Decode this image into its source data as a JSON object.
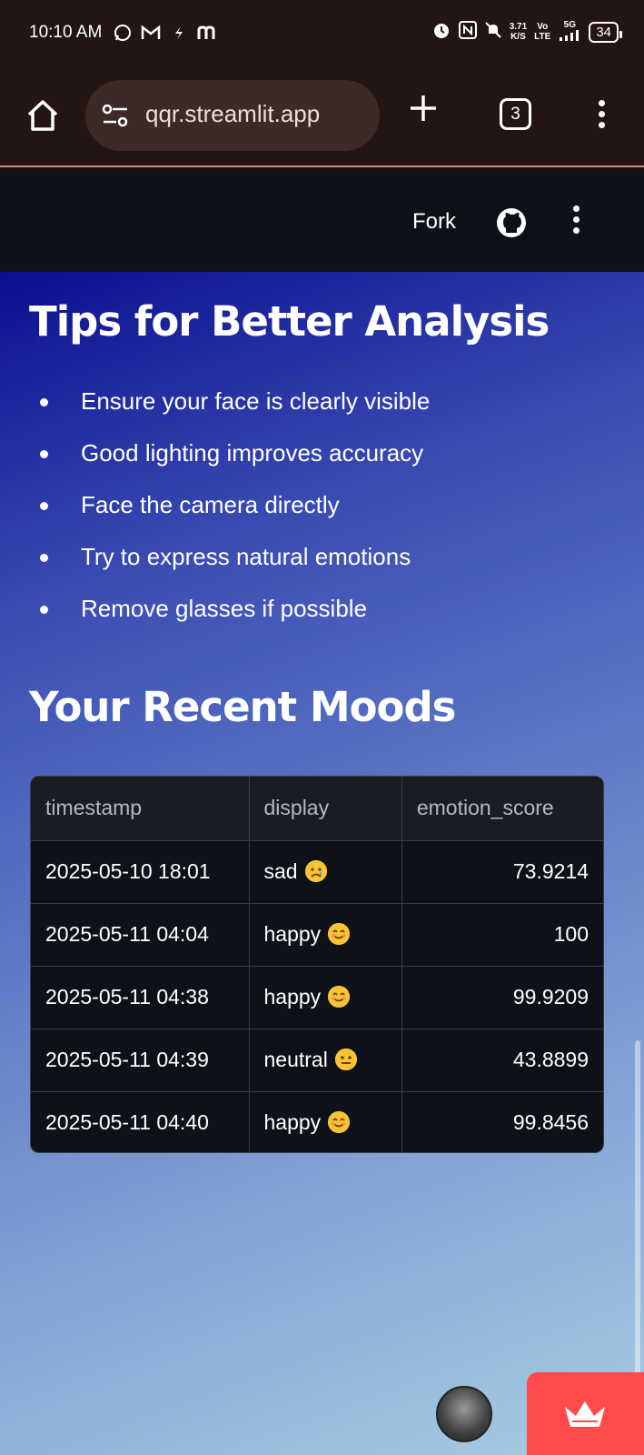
{
  "status_bar": {
    "time": "10:10 AM",
    "app_icons": [
      "whatsapp-icon",
      "gmail-icon",
      "flash-icon",
      "m-icon"
    ],
    "net_speed_value": "3.71",
    "net_speed_unit": "K/S",
    "volte_top": "Vo",
    "volte_bottom": "LTE",
    "network": "5G",
    "battery": "34"
  },
  "browser": {
    "url": "qqr.streamlit.app",
    "tab_count": "3"
  },
  "app_header": {
    "fork_label": "Fork"
  },
  "tips": {
    "title": "Tips for Better Analysis",
    "items": [
      "Ensure your face is clearly visible",
      "Good lighting improves accuracy",
      "Face the camera directly",
      "Try to express natural emotions",
      "Remove glasses if possible"
    ]
  },
  "moods": {
    "title": "Your Recent Moods",
    "columns": [
      "timestamp",
      "display",
      "emotion_score"
    ],
    "rows": [
      {
        "timestamp": "2025-05-10 18:01",
        "display": "sad",
        "emoji": "sad",
        "emotion_score": "73.9214"
      },
      {
        "timestamp": "2025-05-11 04:04",
        "display": "happy",
        "emoji": "happy",
        "emotion_score": "100"
      },
      {
        "timestamp": "2025-05-11 04:38",
        "display": "happy",
        "emoji": "happy",
        "emotion_score": "99.9209"
      },
      {
        "timestamp": "2025-05-11 04:39",
        "display": "neutral",
        "emoji": "neutral",
        "emotion_score": "43.8899"
      },
      {
        "timestamp": "2025-05-11 04:40",
        "display": "happy",
        "emoji": "happy",
        "emotion_score": "99.8456"
      }
    ]
  },
  "colors": {
    "app_header_bg": "#0e1117",
    "streamlit_badge": "#ff4b4b",
    "table_bg": "#0e1117"
  }
}
